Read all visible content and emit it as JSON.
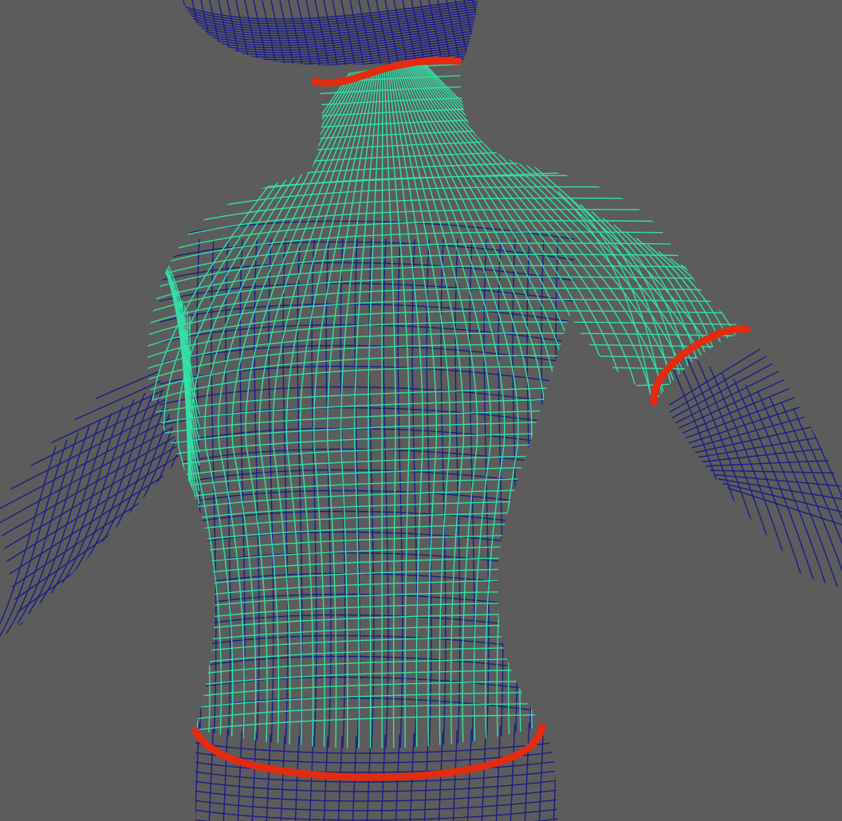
{
  "viewport": {
    "background": "#5c5c5c",
    "body_wire_color": "#1c1c86",
    "selected_wire_color": "#33e0a6",
    "cut_mark_color": "#e62a10"
  },
  "meshes": {
    "body": {
      "state": "unselected"
    },
    "shirt": {
      "state": "selected"
    }
  },
  "cut_marks": [
    "neck",
    "right-sleeve",
    "waist"
  ]
}
